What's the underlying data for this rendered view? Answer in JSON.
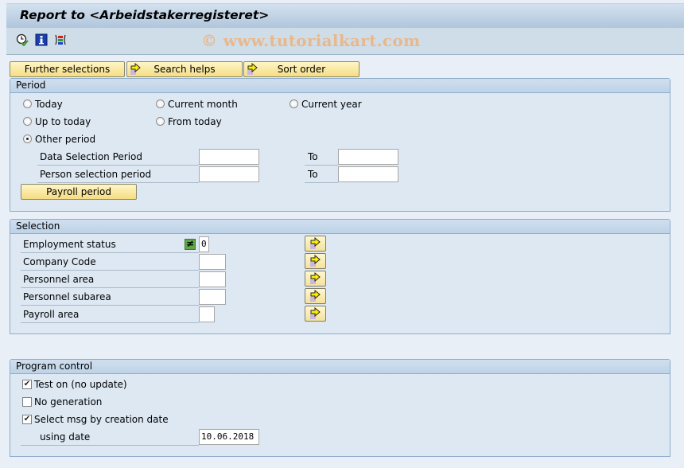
{
  "window": {
    "title": "Report to <Arbeidstakerregisteret>",
    "watermark": "© www.tutorialkart.com"
  },
  "toolbar": {
    "icons": [
      "execute-clock-icon",
      "info-icon",
      "variant-layout-icon"
    ]
  },
  "tab_buttons": [
    {
      "label": "Further selections",
      "icon": null
    },
    {
      "label": "Search helps",
      "icon": "arrow-right-icon"
    },
    {
      "label": "Sort order",
      "icon": "arrow-right-icon"
    }
  ],
  "period": {
    "title": "Period",
    "radios": [
      {
        "label": "Today",
        "selected": false
      },
      {
        "label": "Current month",
        "selected": false
      },
      {
        "label": "Current year",
        "selected": false
      },
      {
        "label": "Up to today",
        "selected": false
      },
      {
        "label": "From today",
        "selected": false
      },
      {
        "label": "Other period",
        "selected": true
      }
    ],
    "ranges": [
      {
        "label": "Data Selection Period",
        "from": "",
        "to_label": "To",
        "to": ""
      },
      {
        "label": "Person selection period",
        "from": "",
        "to_label": "To",
        "to": ""
      }
    ],
    "payroll_button": "Payroll period"
  },
  "selection": {
    "title": "Selection",
    "fields": [
      {
        "label": "Employment status",
        "value": "0",
        "operator": "≠"
      },
      {
        "label": "Company Code",
        "value": ""
      },
      {
        "label": "Personnel area",
        "value": ""
      },
      {
        "label": "Personnel subarea",
        "value": ""
      },
      {
        "label": "Payroll area",
        "value": ""
      }
    ]
  },
  "program_control": {
    "title": "Program control",
    "checkboxes": [
      {
        "label": "Test on (no update)",
        "checked": true
      },
      {
        "label": "No generation",
        "checked": false
      },
      {
        "label": "Select msg by creation date",
        "checked": true
      }
    ],
    "using_date_label": "using date",
    "using_date_value": "10.06.2018"
  }
}
